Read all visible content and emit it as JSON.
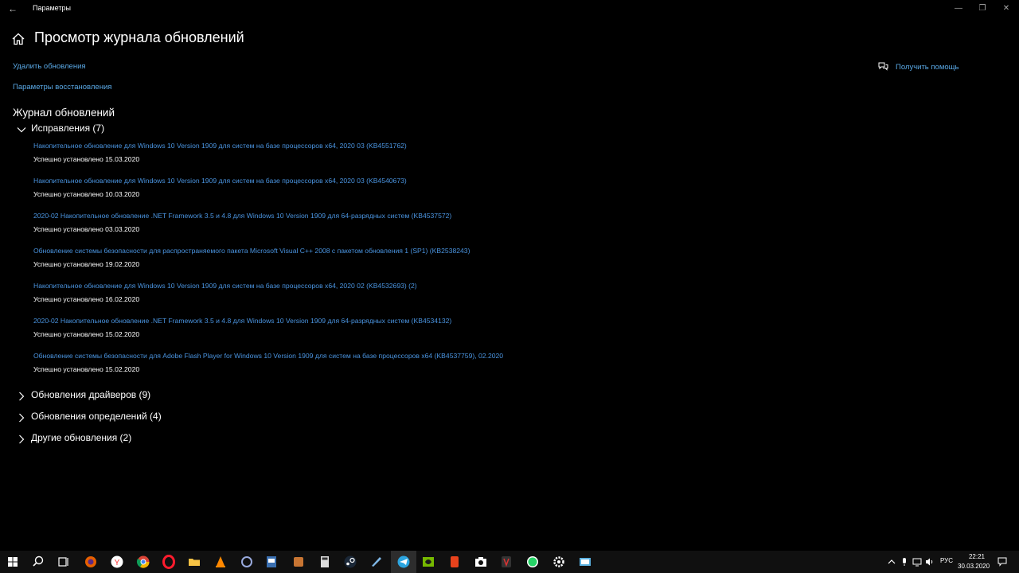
{
  "window": {
    "title": "Параметры",
    "page_title": "Просмотр журнала обновлений",
    "controls": {
      "minimize": "—",
      "restore": "❐",
      "close": "✕"
    }
  },
  "links": {
    "remove_updates": "Удалить обновления",
    "recovery_options": "Параметры восстановления",
    "get_help": "Получить помощь"
  },
  "history": {
    "title": "Журнал обновлений",
    "fixes_section": "Исправления (7)",
    "fixes": [
      {
        "name": "Накопительное обновление для Windows 10 Version 1909 для систем на базе процессоров x64, 2020 03 (KB4551762)",
        "status": "Успешно установлено 15.03.2020"
      },
      {
        "name": "Накопительное обновление для Windows 10 Version 1909 для систем на базе процессоров x64, 2020 03 (KB4540673)",
        "status": "Успешно установлено 10.03.2020"
      },
      {
        "name": "2020-02 Накопительное обновление .NET Framework 3.5 и 4.8 для Windows 10 Version 1909 для 64-разрядных систем (KB4537572)",
        "status": "Успешно установлено 03.03.2020"
      },
      {
        "name": "Обновление системы безопасности для распространяемого пакета Microsoft Visual C++ 2008 с пакетом обновления 1 (SP1) (KB2538243)",
        "status": "Успешно установлено 19.02.2020"
      },
      {
        "name": "Накопительное обновление для Windows 10 Version 1909 для систем на базе процессоров x64, 2020 02 (KB4532693) (2)",
        "status": "Успешно установлено 16.02.2020"
      },
      {
        "name": "2020-02 Накопительное обновление .NET Framework 3.5 и 4.8 для Windows 10 Version 1909 для 64-разрядных систем (KB4534132)",
        "status": "Успешно установлено 15.02.2020"
      },
      {
        "name": "Обновление системы безопасности для Adobe Flash Player for Windows 10 Version 1909 для систем на базе процессоров x64 (KB4537759), 02.2020",
        "status": "Успешно установлено 15.02.2020"
      }
    ],
    "collapsed_sections": [
      "Обновления драйверов (9)",
      "Обновления определений (4)",
      "Другие обновления (2)"
    ]
  },
  "taskbar": {
    "language": "РУС",
    "time": "22:21",
    "date": "30.03.2020",
    "apps": [
      "firefox-icon",
      "yandex-icon",
      "chrome-icon",
      "opera-icon",
      "file-explorer-icon",
      "vlc-icon",
      "app-icon",
      "app-icon",
      "app-icon",
      "calculator-icon",
      "steam-icon",
      "app-icon",
      "telegram-icon",
      "nvidia-icon",
      "app-icon",
      "camera-icon",
      "app-icon",
      "whatsapp-icon",
      "settings-icon",
      "app-icon"
    ]
  },
  "colors": {
    "accent_link": "#4a94e0",
    "background": "#000000",
    "taskbar": "#101010"
  }
}
